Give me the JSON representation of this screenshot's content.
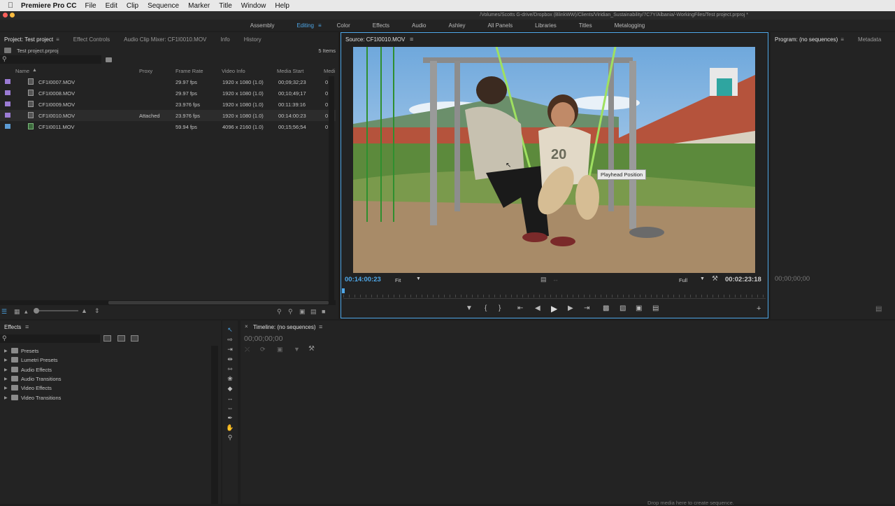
{
  "menubar": {
    "app_name": "Premiere Pro CC",
    "items": [
      "File",
      "Edit",
      "Clip",
      "Sequence",
      "Marker",
      "Title",
      "Window",
      "Help"
    ]
  },
  "path": "/Volumes/Scotts G-drive/Dropbox (BlinkWW)/Clients/Viridian_Sustainability/7C7Y/Albania/-WorkingFiles/Test project.prproj *",
  "workspaces": {
    "items": [
      "Assembly",
      "Editing",
      "Color",
      "Effects",
      "Audio",
      "Ashley",
      "All Panels",
      "Libraries",
      "Titles",
      "Metalogging"
    ],
    "active": "Editing"
  },
  "project_panel": {
    "tabs": [
      "Project: Test project",
      "Effect Controls",
      "Audio Clip Mixer: CF1I0010.MOV",
      "Info",
      "History"
    ],
    "project_file": "Test project.prproj",
    "item_count": "5 Items",
    "columns": [
      "Name",
      "Proxy",
      "Frame Rate",
      "Video Info",
      "Media Start",
      "Medi"
    ],
    "rows": [
      {
        "name": "CF1I0007.MOV",
        "proxy": "",
        "frame_rate": "29.97 fps",
        "video_info": "1920 x 1080 (1.0)",
        "media_start": "00;09;32;23",
        "medi": "0",
        "color": "#9b7bd4"
      },
      {
        "name": "CF1I0008.MOV",
        "proxy": "",
        "frame_rate": "29.97 fps",
        "video_info": "1920 x 1080 (1.0)",
        "media_start": "00;10;49;17",
        "medi": "0",
        "color": "#9b7bd4"
      },
      {
        "name": "CF1I0009.MOV",
        "proxy": "",
        "frame_rate": "23.976 fps",
        "video_info": "1920 x 1080 (1.0)",
        "media_start": "00:11:39:16",
        "medi": "0",
        "color": "#9b7bd4"
      },
      {
        "name": "CF1I0010.MOV",
        "proxy": "Attached",
        "frame_rate": "23.976 fps",
        "video_info": "1920 x 1080 (1.0)",
        "media_start": "00:14:00:23",
        "medi": "0",
        "color": "#9b7bd4"
      },
      {
        "name": "CF1I0011.MOV",
        "proxy": "",
        "frame_rate": "59.94 fps",
        "video_info": "4096 x 2160 (1.0)",
        "media_start": "00;15;56;54",
        "medi": "0",
        "color": "#5b9bd5"
      }
    ]
  },
  "source_monitor": {
    "title": "Source: CF1I0010.MOV",
    "timecode": "00:14:00:23",
    "fit": "Fit",
    "quality": "Full",
    "duration": "00:02:23:18",
    "tooltip": "Playhead Position"
  },
  "program_monitor": {
    "tabs": [
      "Program: (no sequences)",
      "Metadata"
    ],
    "timecode": "00;00;00;00"
  },
  "effects_panel": {
    "title": "Effects",
    "items": [
      "Presets",
      "Lumetri Presets",
      "Audio Effects",
      "Audio Transitions",
      "Video Effects",
      "Video Transitions"
    ]
  },
  "timeline": {
    "title": "Timeline: (no sequences)",
    "timecode": "00;00;00;00",
    "drop_hint": "Drop media here to create sequence."
  },
  "colors": {
    "accent": "#4ea7e8",
    "panel_bg": "#232323"
  }
}
